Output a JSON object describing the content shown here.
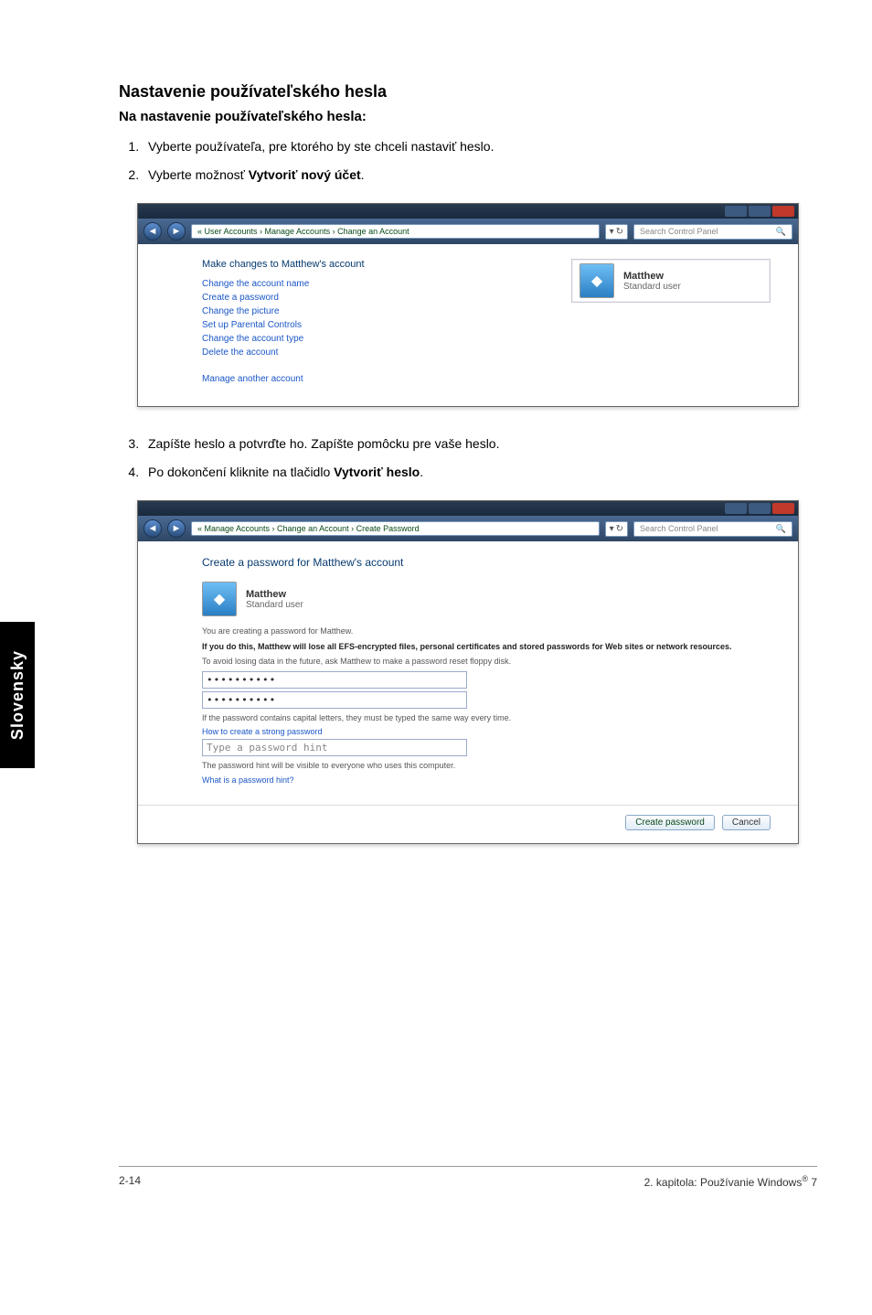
{
  "side_label": "Slovensky",
  "section_title": "Nastavenie používateľského hesla",
  "section_sub": "Na nastavenie používateľského hesla:",
  "steps_a": [
    "Vyberte používateľa, pre ktorého by ste chceli nastaviť heslo.",
    "Vyberte možnosť "
  ],
  "steps_a_bold": "Vytvoriť nový účet",
  "figure1": {
    "breadcrumb": "« User Accounts › Manage Accounts › Change an Account",
    "search_placeholder": "Search Control Panel",
    "heading": "Make changes to Matthew's account",
    "links": [
      "Change the account name",
      "Create a password",
      "Change the picture",
      "Set up Parental Controls",
      "Change the account type",
      "Delete the account"
    ],
    "link_spaced": "Manage another account",
    "user_name": "Matthew",
    "user_role": "Standard user"
  },
  "steps_b_3": "Zapíšte heslo a potvrďte ho. Zapíšte pomôcku pre vaše heslo.",
  "steps_b_4_pre": "Po dokončení kliknite na tlačidlo ",
  "steps_b_4_bold": "Vytvoriť heslo",
  "figure2": {
    "breadcrumb": "« Manage Accounts › Change an Account › Create Password",
    "search_placeholder": "Search Control Panel",
    "heading": "Create a password for Matthew's account",
    "user_name": "Matthew",
    "user_role": "Standard user",
    "line_creating": "You are creating a password for Matthew.",
    "warn_line": "If you do this, Matthew will lose all EFS-encrypted files, personal certificates and stored passwords for Web sites or network resources.",
    "avoid_line": "To avoid losing data in the future, ask Matthew to make a password reset floppy disk.",
    "pw1": "••••••••••",
    "pw2": "••••••••••",
    "caps_line": "If the password contains capital letters, they must be typed the same way every time.",
    "howto_link": "How to create a strong password",
    "hint_placeholder": "Type a password hint",
    "hint_visible": "The password hint will be visible to everyone who uses this computer.",
    "hint_link": "What is a password hint?",
    "btn_create": "Create password",
    "btn_cancel": "Cancel"
  },
  "footer_left": "2-14",
  "footer_right_pre": "2. kapitola: Používanie Windows",
  "footer_right_post": " 7"
}
